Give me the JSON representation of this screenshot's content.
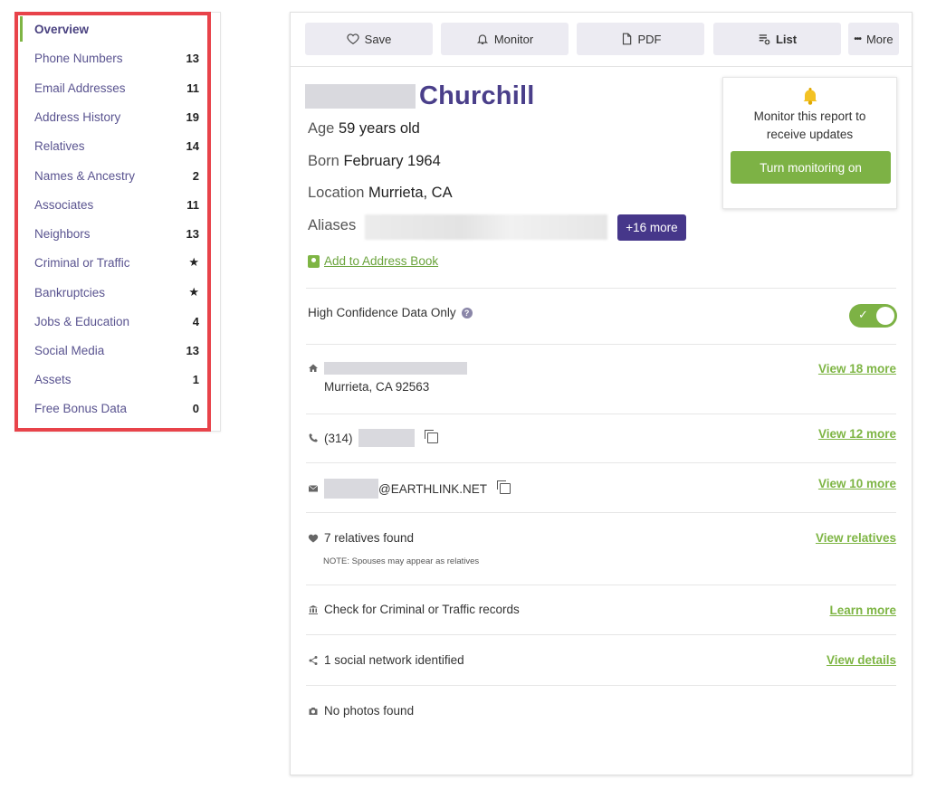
{
  "sidebar": {
    "items": [
      {
        "label": "Overview",
        "count": ""
      },
      {
        "label": "Phone Numbers",
        "count": "13"
      },
      {
        "label": "Email Addresses",
        "count": "11"
      },
      {
        "label": "Address History",
        "count": "19"
      },
      {
        "label": "Relatives",
        "count": "14"
      },
      {
        "label": "Names & Ancestry",
        "count": "2"
      },
      {
        "label": "Associates",
        "count": "11"
      },
      {
        "label": "Neighbors",
        "count": "13"
      },
      {
        "label": "Criminal or Traffic",
        "count": "★"
      },
      {
        "label": "Bankruptcies",
        "count": "★"
      },
      {
        "label": "Jobs & Education",
        "count": "4"
      },
      {
        "label": "Social Media",
        "count": "13"
      },
      {
        "label": "Assets",
        "count": "1"
      },
      {
        "label": "Free Bonus Data",
        "count": "0"
      }
    ]
  },
  "toolbar": {
    "save": "Save",
    "monitor": "Monitor",
    "pdf": "PDF",
    "list": "List",
    "more": "More"
  },
  "profile": {
    "surname": "Churchill",
    "age_label": "Age",
    "age_value": "59 years old",
    "born_label": "Born",
    "born_value": "February 1964",
    "location_label": "Location",
    "location_value": "Murrieta, CA",
    "aliases_label": "Aliases",
    "aliases_more": "+16 more",
    "add_to_address_book": "Add to Address Book"
  },
  "monitor_box": {
    "text": "Monitor this report to receive updates",
    "button": "Turn monitoring on"
  },
  "high_confidence": {
    "label": "High Confidence Data Only",
    "toggle_on": true
  },
  "rows": {
    "address_city": "Murrieta, CA 92563",
    "address_link": "View 18 more",
    "phone_prefix": "(314)",
    "phone_link": "View 12 more",
    "email_domain": "@EARTHLINK.NET",
    "email_link": "View 10 more",
    "relatives_text": "7 relatives found",
    "relatives_note": "NOTE: Spouses may appear as relatives",
    "relatives_link": "View relatives",
    "criminal_text": "Check for Criminal or Traffic records",
    "criminal_link": "Learn more",
    "social_text": "1 social network identified",
    "social_link": "View details",
    "photos_text": "No photos found"
  },
  "colors": {
    "brand_purple": "#46378a",
    "accent_green": "#7db245",
    "highlight_red": "#e8434a"
  }
}
